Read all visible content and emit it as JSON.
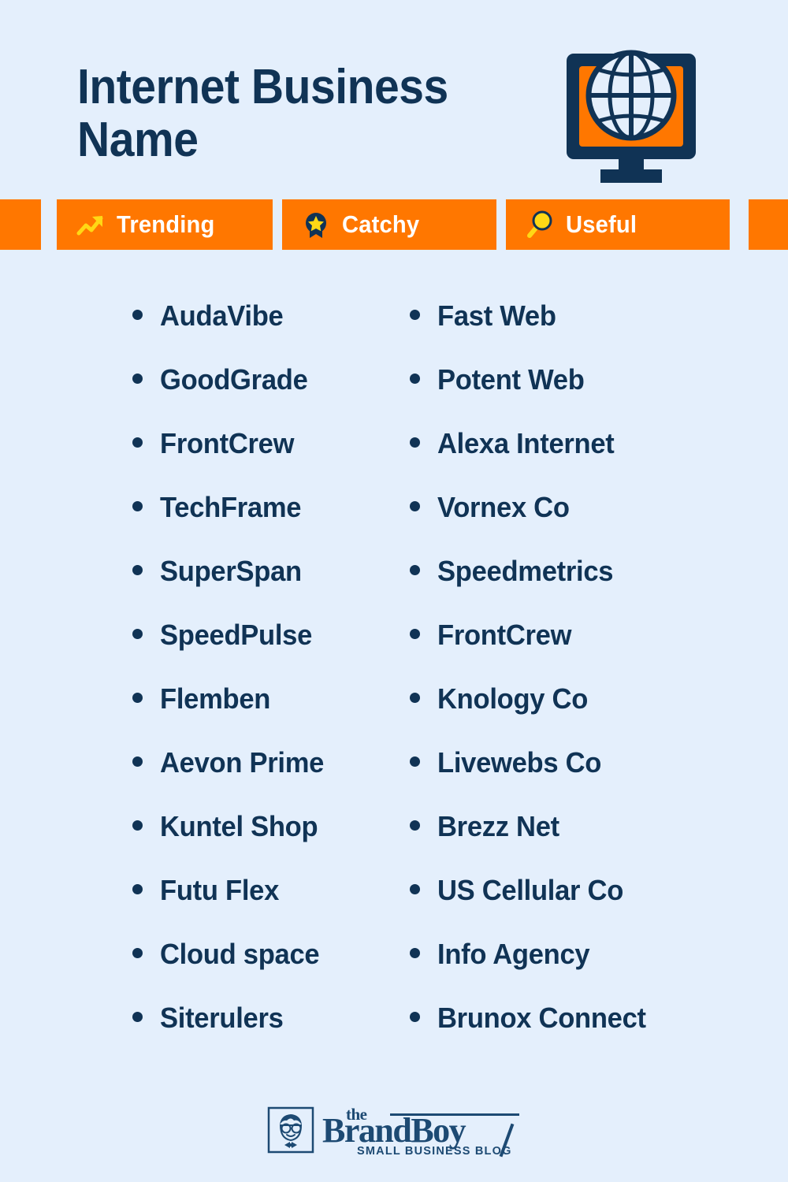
{
  "page": {
    "background_color": "#E4EFFC",
    "accent_color": "#FF7700",
    "text_color": "#103355",
    "highlight_color": "#FFD815"
  },
  "header": {
    "title": "Internet Business Name",
    "icon_name": "monitor-globe-icon"
  },
  "badges": [
    {
      "label": "Trending",
      "icon": "trending-up-arrow-icon"
    },
    {
      "label": "Catchy",
      "icon": "award-star-ribbon-icon"
    },
    {
      "label": "Useful",
      "icon": "magnifying-glass-icon"
    }
  ],
  "lists": {
    "left_column": [
      "AudaVibe",
      "GoodGrade",
      "FrontCrew",
      "TechFrame",
      "SuperSpan",
      "SpeedPulse",
      "Flemben",
      "Aevon Prime",
      "Kuntel Shop",
      "Futu Flex",
      "Cloud space",
      "Siterulers"
    ],
    "right_column": [
      "Fast Web",
      "Potent Web",
      "Alexa Internet",
      "Vornex Co",
      "Speedmetrics",
      "FrontCrew",
      "Knology Co",
      "Livewebs Co",
      "Brezz Net",
      "US Cellular Co",
      "Info Agency",
      "Brunox Connect"
    ]
  },
  "footer": {
    "logo_the": "the",
    "logo_main": "BrandBoy",
    "logo_tagline": "SMALL BUSINESS BLOG",
    "logo_mark_name": "boy-with-glasses-icon"
  }
}
